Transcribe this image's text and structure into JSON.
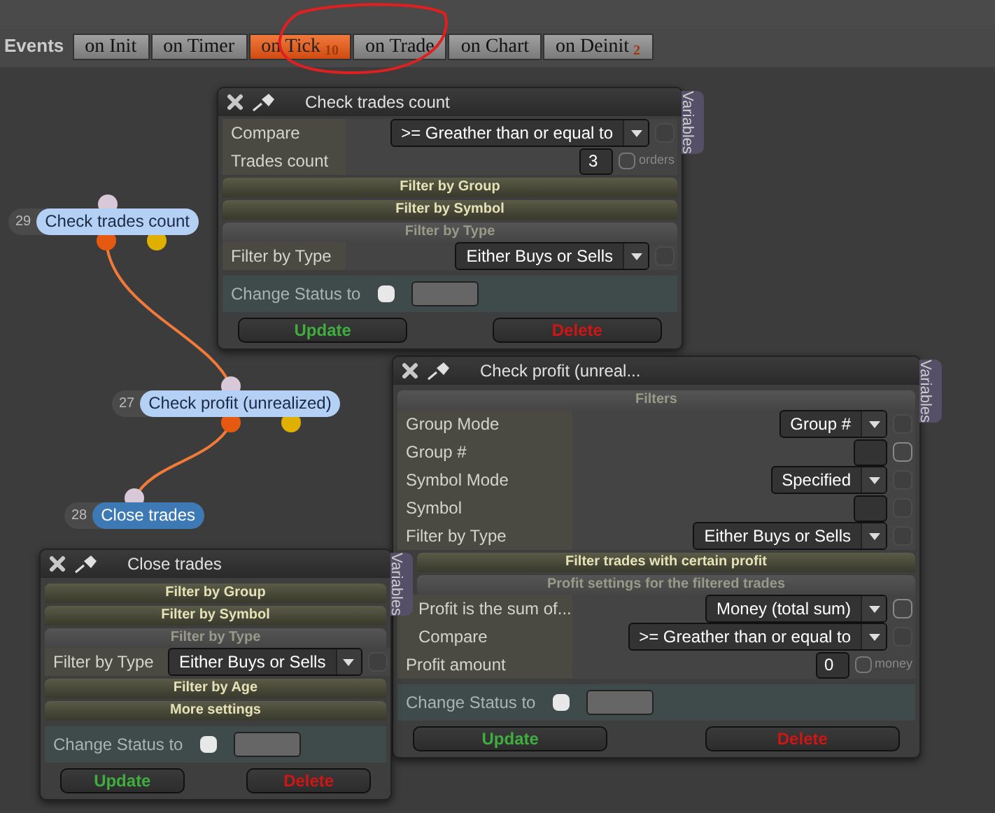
{
  "events_label": "Events",
  "tabs": [
    {
      "label": "on Init",
      "selected": false
    },
    {
      "label": "on Timer",
      "selected": false
    },
    {
      "label": "on Tick",
      "badge": "10",
      "selected": true
    },
    {
      "label": "on Trade",
      "selected": false
    },
    {
      "label": "on Chart",
      "selected": false
    },
    {
      "label": "on Deinit",
      "badge": "2",
      "selected": false
    }
  ],
  "nodes": [
    {
      "number": "29",
      "label": "Check trades count",
      "selected": false
    },
    {
      "number": "27",
      "label": "Check profit (unrealized)",
      "selected": false
    },
    {
      "number": "28",
      "label": "Close trades",
      "selected": true
    }
  ],
  "panels": [
    {
      "title": "Check trades count",
      "side_tab": "Variables",
      "items": [
        {
          "kind": "select",
          "label": "Compare",
          "value": ">= Greather than or equal to",
          "option_disabled": true,
          "option_checked": false
        },
        {
          "kind": "number",
          "label": "Trades count",
          "value": "3",
          "unit": "orders",
          "unit_checked": false
        },
        {
          "kind": "collapsed",
          "label": "Filter by Group"
        },
        {
          "kind": "collapsed",
          "label": "Filter by Symbol"
        },
        {
          "kind": "header",
          "label": "Filter by Type"
        },
        {
          "kind": "select",
          "label": "Filter by Type",
          "value": "Either Buys or Sells",
          "option_disabled": true,
          "option_checked": false
        }
      ],
      "status_label": "Change Status to",
      "status_checked": false,
      "buttons": [
        "Update",
        "Delete"
      ]
    },
    {
      "title": "Check profit (unreal...",
      "side_tab": "Variables",
      "items": [
        {
          "kind": "header",
          "label": "Filters"
        },
        {
          "kind": "select",
          "label": "Group Mode",
          "value": "Group #",
          "option_disabled": true,
          "option_checked": false
        },
        {
          "kind": "input",
          "label": "Group #",
          "option_disabled": false,
          "option_checked": false
        },
        {
          "kind": "select",
          "label": "Symbol Mode",
          "value": "Specified",
          "option_disabled": true,
          "option_checked": false
        },
        {
          "kind": "input",
          "label": "Symbol",
          "option_disabled": true,
          "option_checked": false
        },
        {
          "kind": "select",
          "label": "Filter by Type",
          "value": "Either Buys or Sells",
          "option_disabled": true,
          "option_checked": false
        },
        {
          "kind": "collapsed",
          "label": "Filter trades with certain profit"
        },
        {
          "kind": "header",
          "label": "Profit settings for the filtered trades"
        },
        {
          "kind": "select",
          "label": "Profit is the sum of...",
          "value": "Money (total sum)",
          "option_disabled": false,
          "option_checked": false
        },
        {
          "kind": "select",
          "label": "Compare",
          "value": ">= Greather than or equal to",
          "option_disabled": true,
          "option_checked": false
        },
        {
          "kind": "number",
          "label": "Profit amount",
          "value": "0",
          "unit": "money",
          "unit_checked": false
        }
      ],
      "status_label": "Change Status to",
      "status_checked": false,
      "buttons": [
        "Update",
        "Delete"
      ]
    },
    {
      "title": "Close trades",
      "side_tab": "Variables",
      "items": [
        {
          "kind": "collapsed",
          "label": "Filter by Group"
        },
        {
          "kind": "collapsed",
          "label": "Filter by Symbol"
        },
        {
          "kind": "header",
          "label": "Filter by Type"
        },
        {
          "kind": "select",
          "label": "Filter by Type",
          "value": "Either Buys or Sells",
          "option_disabled": true,
          "option_checked": false
        },
        {
          "kind": "collapsed",
          "label": "Filter by Age"
        },
        {
          "kind": "collapsed",
          "label": "More settings"
        }
      ],
      "status_label": "Change Status to",
      "status_checked": false,
      "buttons": [
        "Update",
        "Delete"
      ]
    }
  ]
}
